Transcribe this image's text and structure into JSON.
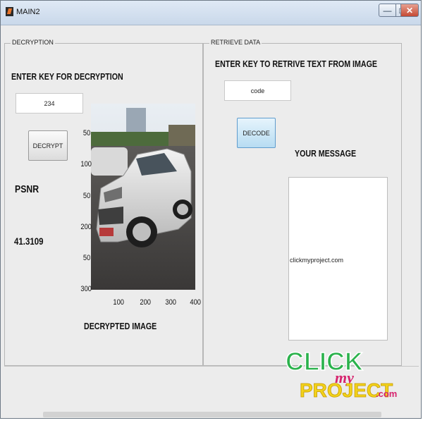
{
  "window": {
    "title": "MAIN2",
    "controls": {
      "minimize": "—",
      "maximize": "□",
      "close": "✕"
    }
  },
  "decryption": {
    "panel_title": "DECRYPTION",
    "key_label": "ENTER KEY FOR DECRYPTION",
    "key_value": "234",
    "decrypt_button": "DECRYPT",
    "psnr_label": "PSNR",
    "psnr_value": "41.3109",
    "image_caption": "DECRYPTED IMAGE",
    "y_ticks": [
      "50",
      "100",
      "50",
      "200",
      "50",
      "300"
    ],
    "x_ticks": [
      "100",
      "200",
      "300",
      "400"
    ]
  },
  "retrieve": {
    "panel_title": "RETRIEVE DATA",
    "key_label": "ENTER KEY TO RETRIVE TEXT FROM IMAGE",
    "key_value": "code",
    "decode_button": "DECODE",
    "message_label": "YOUR MESSAGE",
    "message_text": "clickmyproject.com"
  },
  "watermark": {
    "line1": "CLICK",
    "line2": "my",
    "line3": "PROJECT",
    "suffix": ".com"
  },
  "colors": {
    "accent_blue": "#b7dcf2",
    "logo_green": "#2bb24c",
    "logo_yellow": "#f2d21b",
    "logo_pink": "#d6246e"
  }
}
